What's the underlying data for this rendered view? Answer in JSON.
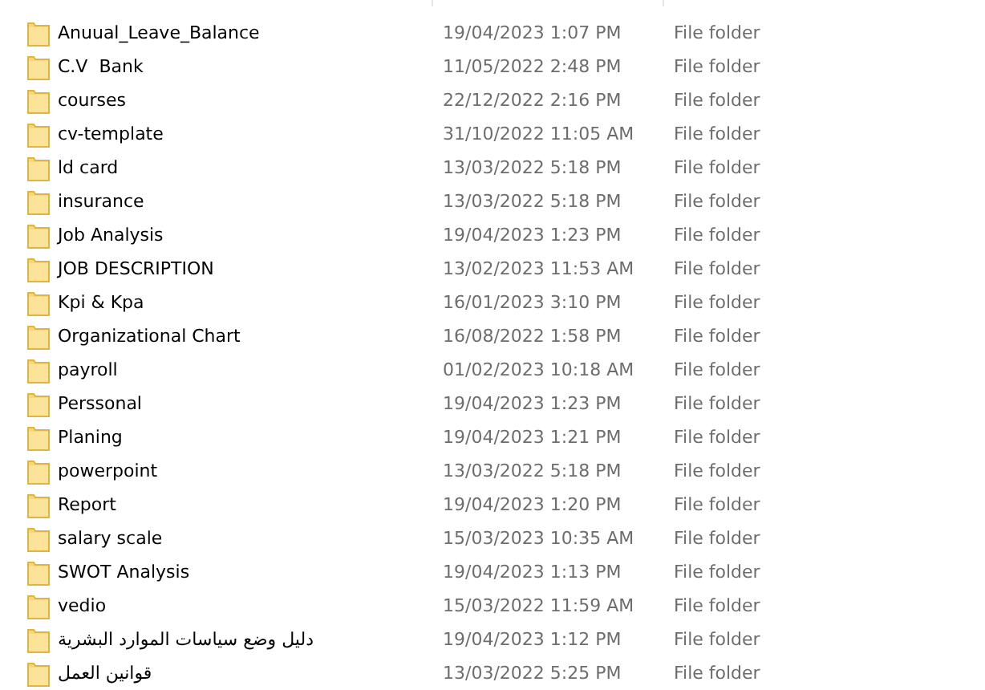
{
  "rows": [
    {
      "name": "Anuual_Leave_Balance",
      "date_modified": "19/04/2023 1:07 PM",
      "type": "File folder"
    },
    {
      "name": "C.V  Bank",
      "date_modified": "11/05/2022 2:48 PM",
      "type": "File folder"
    },
    {
      "name": "courses",
      "date_modified": "22/12/2022 2:16 PM",
      "type": "File folder"
    },
    {
      "name": "cv-template",
      "date_modified": "31/10/2022 11:05 AM",
      "type": "File folder"
    },
    {
      "name": "ld card",
      "date_modified": "13/03/2022 5:18 PM",
      "type": "File folder"
    },
    {
      "name": "insurance",
      "date_modified": "13/03/2022 5:18 PM",
      "type": "File folder"
    },
    {
      "name": "Job Analysis",
      "date_modified": "19/04/2023 1:23 PM",
      "type": "File folder"
    },
    {
      "name": "JOB DESCRIPTION",
      "date_modified": "13/02/2023 11:53 AM",
      "type": "File folder"
    },
    {
      "name": "Kpi & Kpa",
      "date_modified": "16/01/2023 3:10 PM",
      "type": "File folder"
    },
    {
      "name": "Organizational Chart",
      "date_modified": "16/08/2022 1:58 PM",
      "type": "File folder"
    },
    {
      "name": "payroll",
      "date_modified": "01/02/2023 10:18 AM",
      "type": "File folder"
    },
    {
      "name": "Perssonal",
      "date_modified": "19/04/2023 1:23 PM",
      "type": "File folder"
    },
    {
      "name": "Planing",
      "date_modified": "19/04/2023 1:21 PM",
      "type": "File folder"
    },
    {
      "name": "powerpoint",
      "date_modified": "13/03/2022 5:18 PM",
      "type": "File folder"
    },
    {
      "name": "Report",
      "date_modified": "19/04/2023 1:20 PM",
      "type": "File folder"
    },
    {
      "name": "salary scale",
      "date_modified": "15/03/2023 10:35 AM",
      "type": "File folder"
    },
    {
      "name": "SWOT Analysis",
      "date_modified": "19/04/2023 1:13 PM",
      "type": "File folder"
    },
    {
      "name": "vedio",
      "date_modified": "15/03/2022 11:59 AM",
      "type": "File folder"
    },
    {
      "name": "دليل وضع سياسات الموارد البشرية",
      "date_modified": "19/04/2023 1:12 PM",
      "type": "File folder"
    },
    {
      "name": "قوانين العمل",
      "date_modified": "13/03/2022 5:25 PM",
      "type": "File folder"
    }
  ]
}
